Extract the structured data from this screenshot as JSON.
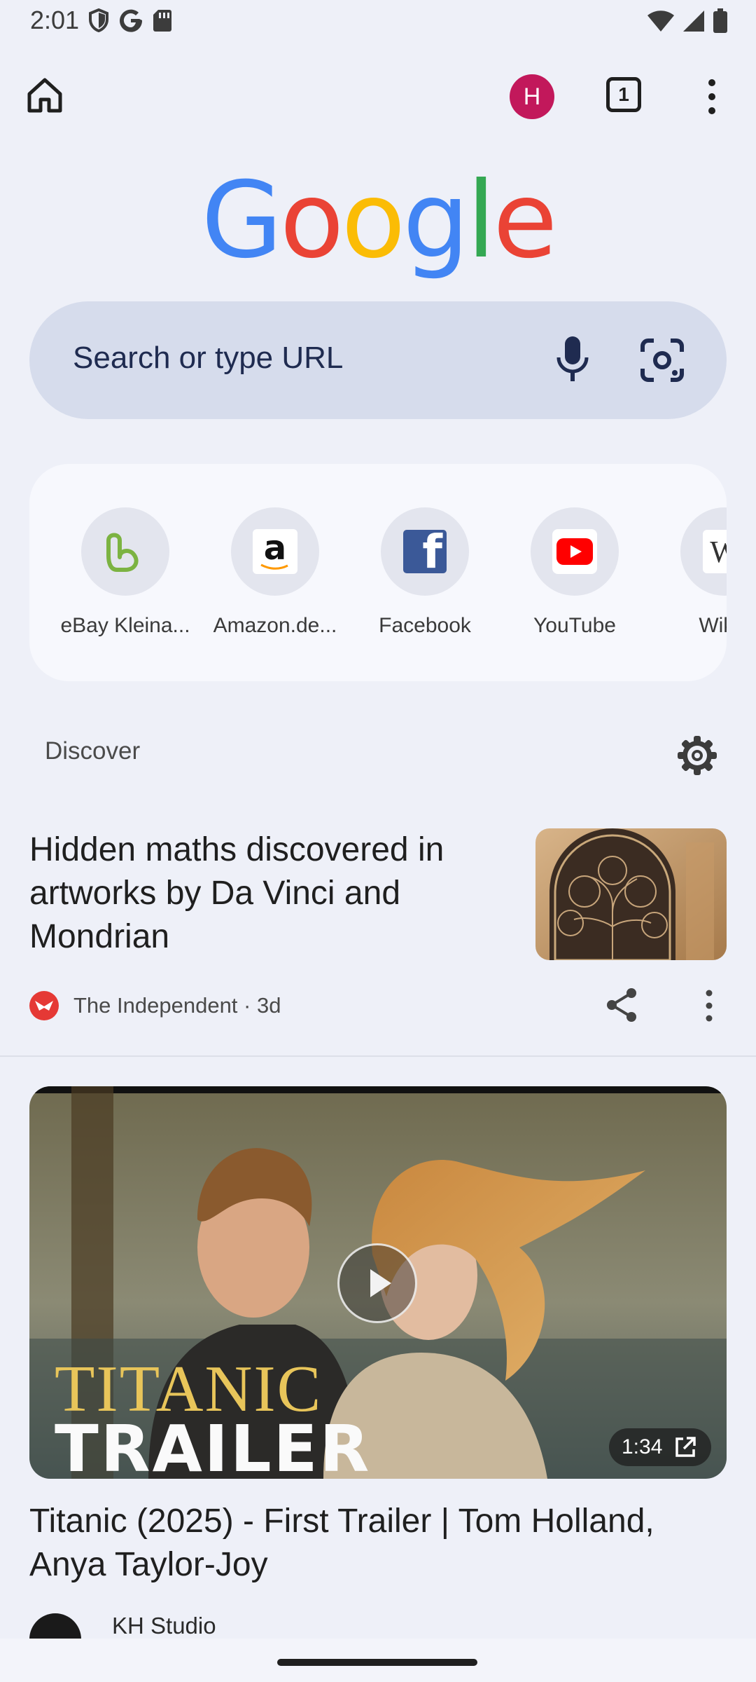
{
  "status_bar": {
    "time": "2:01"
  },
  "toolbar": {
    "profile_initial": "H",
    "tab_count": "1"
  },
  "logo": {
    "text": "Google"
  },
  "search": {
    "placeholder": "Search or type URL"
  },
  "shortcuts": [
    {
      "label": "eBay Kleina...",
      "icon": "ebay-kleinanzeigen-icon"
    },
    {
      "label": "Amazon.de...",
      "icon": "amazon-icon"
    },
    {
      "label": "Facebook",
      "icon": "facebook-icon"
    },
    {
      "label": "YouTube",
      "icon": "youtube-icon"
    },
    {
      "label": "Wikip",
      "icon": "wikipedia-icon"
    }
  ],
  "discover": {
    "title": "Discover"
  },
  "articles": [
    {
      "title": "Hidden maths discovered in artworks by Da Vinci and Mondrian",
      "source": "The Independent · 3d"
    },
    {
      "title": "Titanic (2025) - First Trailer | Tom Holland, Anya Taylor-Joy",
      "overlay_line1": "TITANIC",
      "overlay_line2": "TRAILER",
      "duration": "1:34",
      "channel": "KH Studio"
    }
  ],
  "colors": {
    "background": "#eef0f8",
    "search_bg": "#d6dcec",
    "avatar": "#c2185b"
  }
}
